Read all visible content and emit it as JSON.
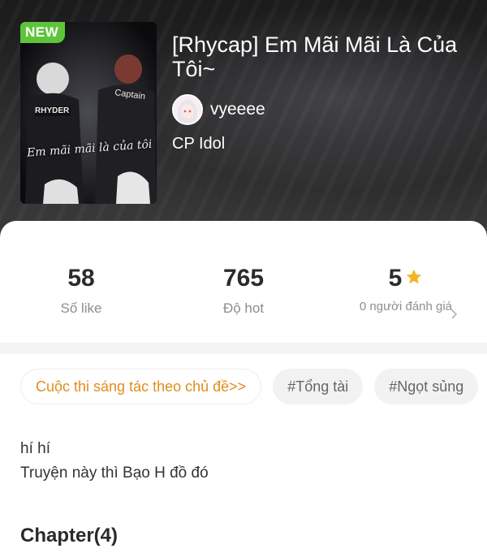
{
  "story": {
    "badge": "NEW",
    "cover_caption": "Em mãi mãi là của tôi",
    "title": "[Rhycap] Em Mãi Mãi Là Của Tôi~",
    "author": "vyeeee",
    "category": "CP Idol"
  },
  "stats": {
    "likes": {
      "value": "58",
      "label": "Số like"
    },
    "hot": {
      "value": "765",
      "label": "Độ hot"
    },
    "rating": {
      "value": "5",
      "label": "0 người đánh giá"
    }
  },
  "tags": [
    {
      "label": "Cuộc thi sáng tác theo chủ đề>>"
    },
    {
      "label": "#Tổng tài"
    },
    {
      "label": "#Ngọt sủng"
    }
  ],
  "description": {
    "line1": "hí hí",
    "line2": "Truyện này thì Bạo H đồ đó"
  },
  "chapters": {
    "heading": "Chapter(4)"
  },
  "colors": {
    "new_badge": "#5ec53a",
    "contest_tag": "#e08d1c",
    "star": "#f5b321",
    "hero_bg": "#1b1b1c"
  },
  "icons": {
    "rating": "star-icon",
    "more": "chevron-right-icon"
  }
}
